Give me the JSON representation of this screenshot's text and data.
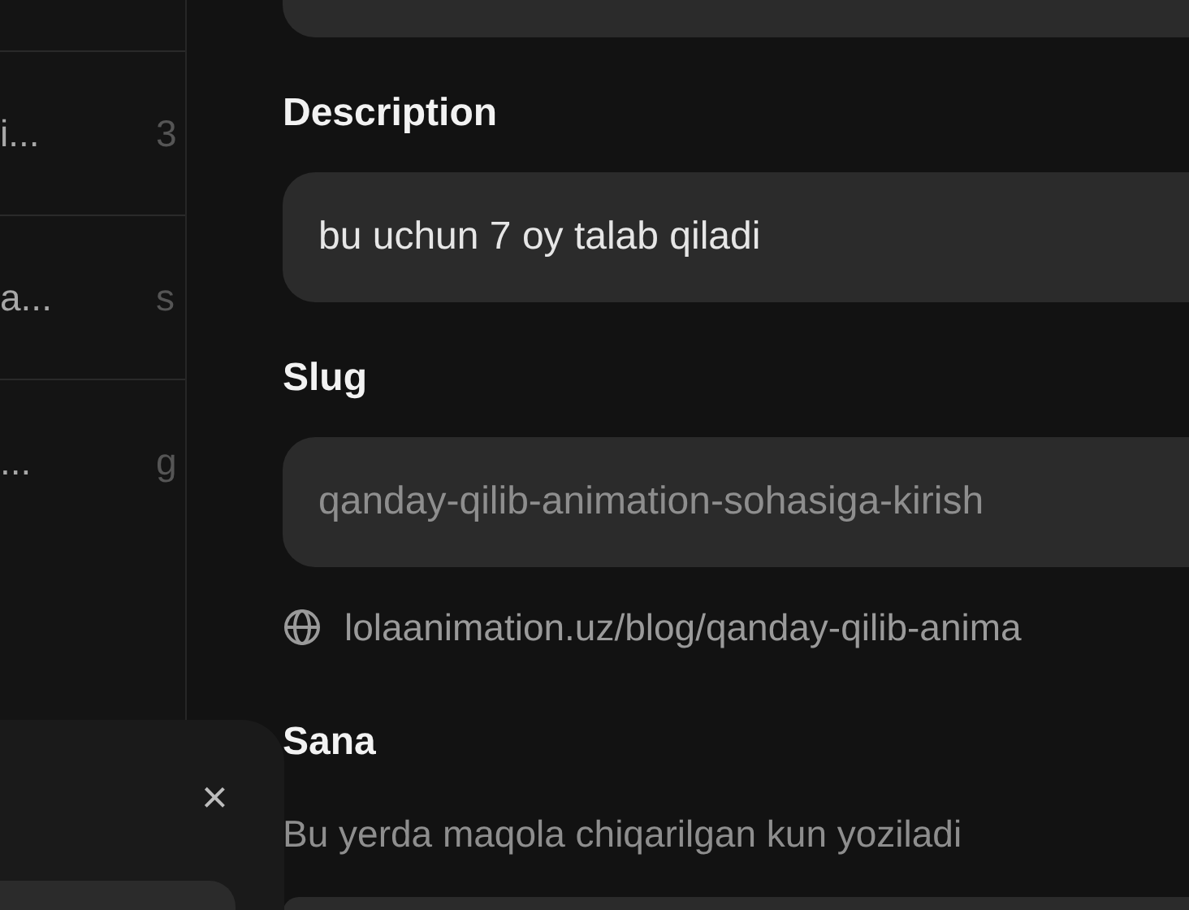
{
  "table": {
    "rows": [
      {
        "column_1": "i...",
        "column_2": "3"
      },
      {
        "column_1": "a...",
        "column_2": "s"
      },
      {
        "column_1": "...",
        "column_2": "g"
      }
    ]
  },
  "form": {
    "items": [
      {
        "kind": "input"
      },
      {
        "kind": "label",
        "text": "Description"
      },
      {
        "kind": "input",
        "value": "bu uchun 7 oy talab qiladi",
        "disabled": false
      },
      {
        "kind": "label",
        "text": "Slug"
      },
      {
        "kind": "input",
        "value": "qanday-qilib-animation-sohasiga-kirish",
        "disabled": true
      },
      {
        "kind": "link",
        "text": "lolaanimation.uz/blog/qanday-qilib-anima"
      },
      {
        "kind": "label",
        "text": "Sana"
      },
      {
        "kind": "hint",
        "text": "Bu yerda maqola chiqarilgan kun yoziladi"
      },
      {
        "kind": "input"
      }
    ]
  },
  "dialog": {
    "close": "×"
  }
}
